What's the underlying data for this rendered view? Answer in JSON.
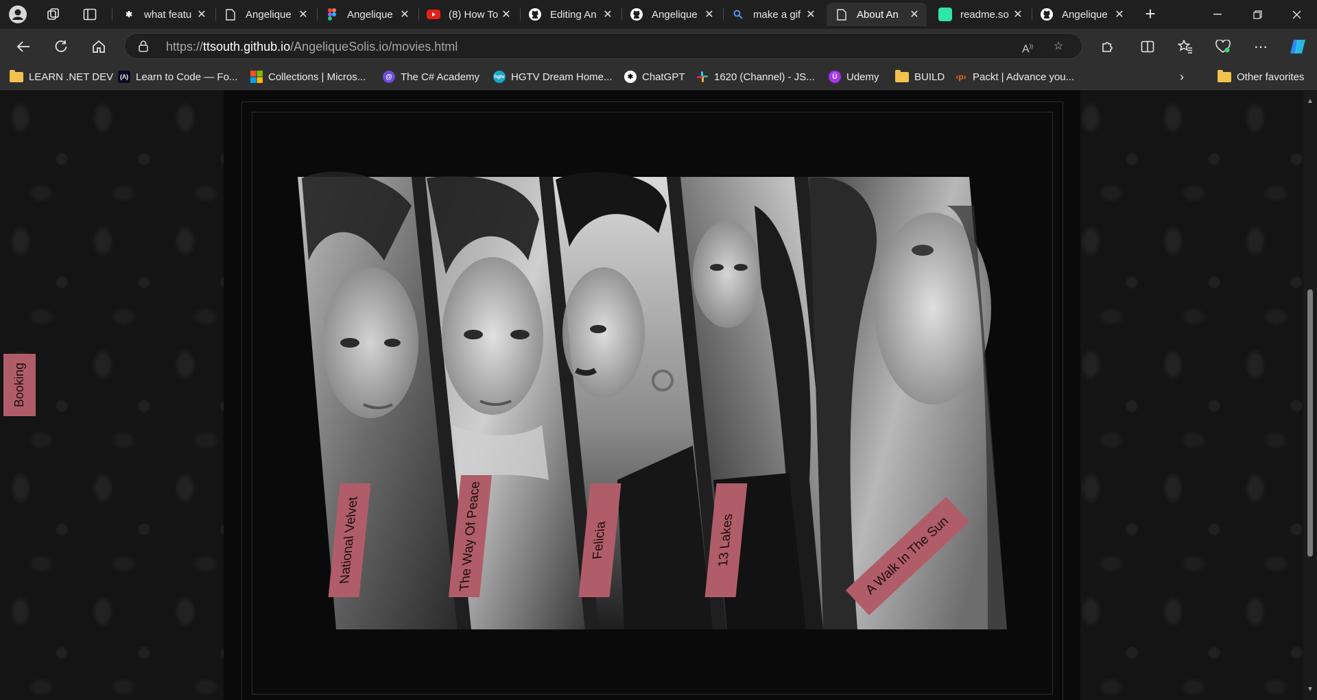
{
  "tabs": [
    {
      "title": "what featu",
      "icon": "chatgpt-icon",
      "active": false
    },
    {
      "title": "Angelique",
      "icon": "page-icon",
      "active": false
    },
    {
      "title": "Angelique",
      "icon": "figma-icon",
      "active": false
    },
    {
      "title": "(8) How To",
      "icon": "youtube-icon",
      "active": false
    },
    {
      "title": "Editing An",
      "icon": "github-icon",
      "active": false
    },
    {
      "title": "Angelique",
      "icon": "github-icon",
      "active": false
    },
    {
      "title": "make a gif",
      "icon": "search-icon",
      "active": false
    },
    {
      "title": "About An",
      "icon": "page-icon",
      "active": true
    },
    {
      "title": "readme.so",
      "icon": "readme-icon",
      "active": false
    },
    {
      "title": "Angelique",
      "icon": "github-icon",
      "active": false
    }
  ],
  "address": {
    "url_prefix": "https://",
    "url_host": "ttsouth.github.io",
    "url_path": "/AngeliqueSolis.io/movies.html"
  },
  "favorites": [
    {
      "label": "LEARN .NET DEV",
      "icon": "folder-icon"
    },
    {
      "label": "Learn to Code — Fo...",
      "icon": "freecodecamp-icon"
    },
    {
      "label": "Collections | Micros...",
      "icon": "microsoft-icon"
    },
    {
      "label": "The C# Academy",
      "icon": "csharp-academy-icon"
    },
    {
      "label": "HGTV Dream Home...",
      "icon": "hgtv-icon"
    },
    {
      "label": "ChatGPT",
      "icon": "chatgpt-icon"
    },
    {
      "label": "1620 (Channel) - JS...",
      "icon": "slack-icon"
    },
    {
      "label": "Udemy",
      "icon": "udemy-icon"
    },
    {
      "label": "BUILD",
      "icon": "folder-icon"
    },
    {
      "label": "Packt | Advance you...",
      "icon": "packt-icon"
    }
  ],
  "favorites_other": "Other favorites",
  "page": {
    "booking_label": "Booking",
    "movies": [
      {
        "title": "National Velvet"
      },
      {
        "title": "The Way Of Peace"
      },
      {
        "title": "Felicia"
      },
      {
        "title": "13 Lakes"
      },
      {
        "title": "A Walk In The Sun"
      }
    ],
    "colors": {
      "accent": "#b05d69",
      "background": "#0a0a0a",
      "wallpaper": "#141414"
    }
  }
}
